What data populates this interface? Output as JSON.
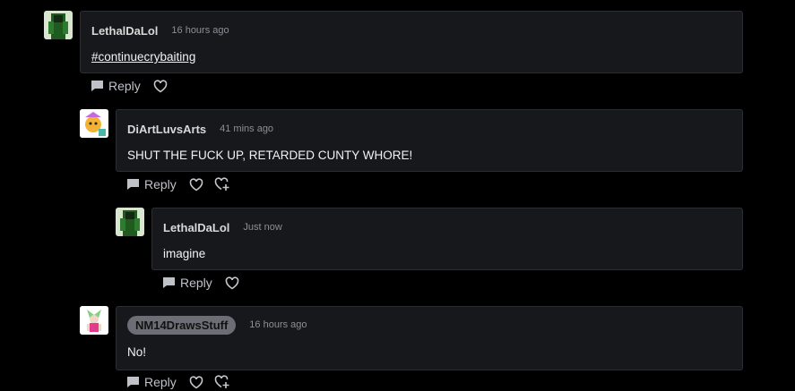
{
  "comments": [
    {
      "username": "LethalDaLol",
      "time": "16 hours ago",
      "text": "#continuecrybaiting",
      "reply_label": "Reply",
      "avatar_icon": "green-character-avatar"
    },
    {
      "username": "DiArtLuvsArts",
      "time": "41 mins ago",
      "text": "SHUT THE FUCK UP, RETARDED CUNTY WHORE!",
      "reply_label": "Reply",
      "avatar_icon": "cartoon-avatar"
    },
    {
      "username": "LethalDaLol",
      "time": "Just now",
      "text": "imagine",
      "reply_label": "Reply",
      "avatar_icon": "green-character-avatar"
    },
    {
      "username": "NM14DrawsStuff",
      "time": "16 hours ago",
      "text": "No!",
      "reply_label": "Reply",
      "avatar_icon": "pink-character-avatar"
    }
  ],
  "colors": {
    "background": "#000000",
    "bubble": "#16181c",
    "border": "#2b2e33",
    "username_pill": "#6b6e75"
  }
}
